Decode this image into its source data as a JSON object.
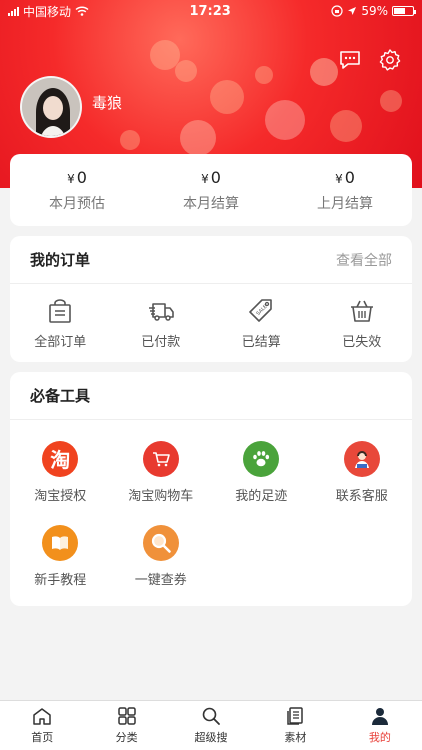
{
  "status_bar": {
    "carrier": "中国移动",
    "time": "17:23",
    "battery": "59%"
  },
  "header": {
    "username": "毒狼"
  },
  "earnings": [
    {
      "currency": "¥",
      "value": "0",
      "label": "本月预估"
    },
    {
      "currency": "¥",
      "value": "0",
      "label": "本月结算"
    },
    {
      "currency": "¥",
      "value": "0",
      "label": "上月结算"
    }
  ],
  "orders": {
    "title": "我的订单",
    "see_all": "查看全部",
    "items": [
      {
        "label": "全部订单",
        "icon": "bag-icon"
      },
      {
        "label": "已付款",
        "icon": "truck-icon"
      },
      {
        "label": "已结算",
        "icon": "sale-tag-icon"
      },
      {
        "label": "已失效",
        "icon": "basket-icon"
      }
    ]
  },
  "tools": {
    "title": "必备工具",
    "items": [
      {
        "label": "淘宝授权",
        "icon": "taobao-icon",
        "glyph": "淘",
        "color": "#f0431f"
      },
      {
        "label": "淘宝购物车",
        "icon": "cart-icon",
        "color": "#e83a2f"
      },
      {
        "label": "我的足迹",
        "icon": "paw-icon",
        "color": "#4aa33b"
      },
      {
        "label": "联系客服",
        "icon": "service-icon",
        "color": "#e8483a"
      },
      {
        "label": "新手教程",
        "icon": "book-icon",
        "color": "#f2901c"
      },
      {
        "label": "一键查券",
        "icon": "coupon-search-icon",
        "color": "#f0913a"
      }
    ]
  },
  "tabbar": {
    "items": [
      {
        "label": "首页",
        "icon": "home-icon"
      },
      {
        "label": "分类",
        "icon": "category-icon"
      },
      {
        "label": "超级搜",
        "icon": "search-icon"
      },
      {
        "label": "素材",
        "icon": "material-icon"
      },
      {
        "label": "我的",
        "icon": "profile-icon",
        "active": true
      }
    ]
  },
  "colors": {
    "brand_red": "#e8413a",
    "header_red": "#f52a2a"
  }
}
